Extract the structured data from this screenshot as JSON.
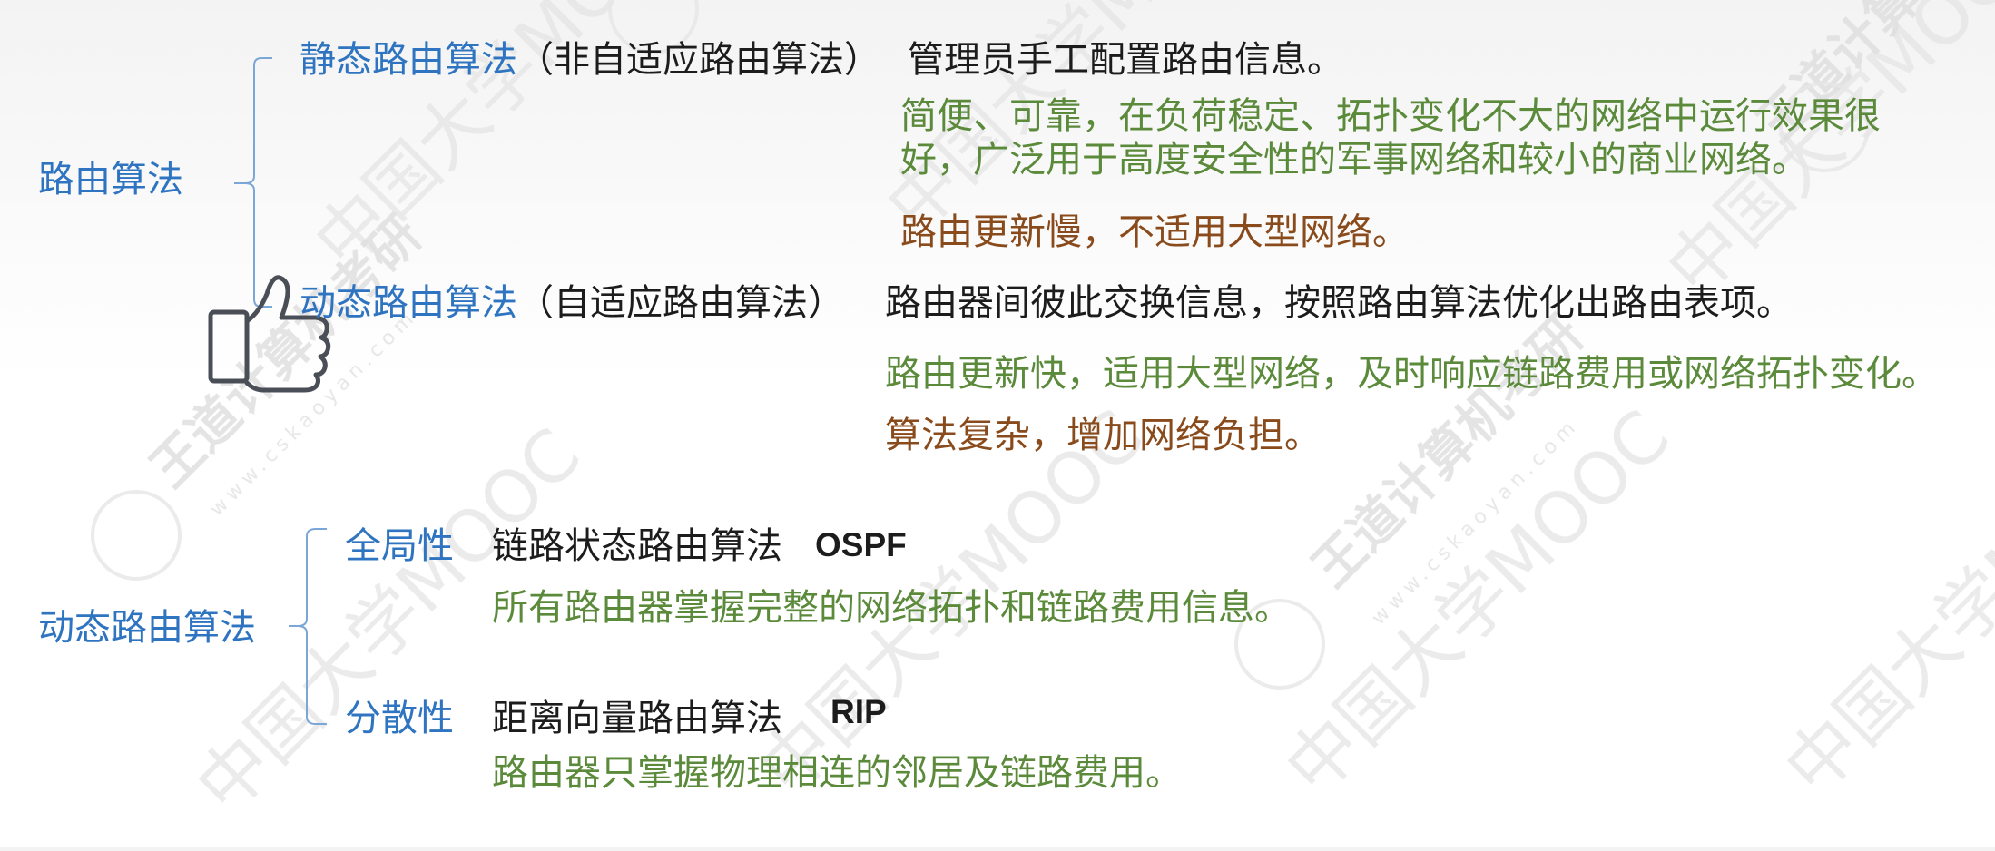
{
  "colors": {
    "blue": "#2e74c0",
    "green": "#5a8a3a",
    "brown": "#8a4b1c",
    "black": "#1c1c1c",
    "bracket": "#6f9fd6"
  },
  "top": {
    "root": "路由算法",
    "static": {
      "name": "静态路由算法",
      "paren": "（非自适应路由算法）",
      "desc": "管理员手工配置路由信息。",
      "pro_line1": "简便、可靠，在负荷稳定、拓扑变化不大的网络中运行效果很",
      "pro_line2": "好，广泛用于高度安全性的军事网络和较小的商业网络。",
      "con": "路由更新慢，不适用大型网络。"
    },
    "dynamic": {
      "name": "动态路由算法",
      "paren": "（自适应路由算法）",
      "desc": "路由器间彼此交换信息，按照路由算法优化出路由表项。",
      "pro": "路由更新快，适用大型网络，及时响应链路费用或网络拓扑变化。",
      "con": "算法复杂，增加网络负担。"
    },
    "icon": "thumbs-up-icon"
  },
  "bottom": {
    "root": "动态路由算法",
    "global": {
      "label": "全局性",
      "algo": "链路状态路由算法",
      "proto": "OSPF",
      "desc": "所有路由器掌握完整的网络拓扑和链路费用信息。"
    },
    "distributed": {
      "label": "分散性",
      "algo": "距离向量路由算法",
      "proto": "RIP",
      "desc": "路由器只掌握物理相连的邻居及链路费用。"
    }
  },
  "watermark": {
    "text_mooc": "中国大学MOOC",
    "text_brand": "王道计算机考研",
    "url": "www.cskaoyan.com"
  }
}
